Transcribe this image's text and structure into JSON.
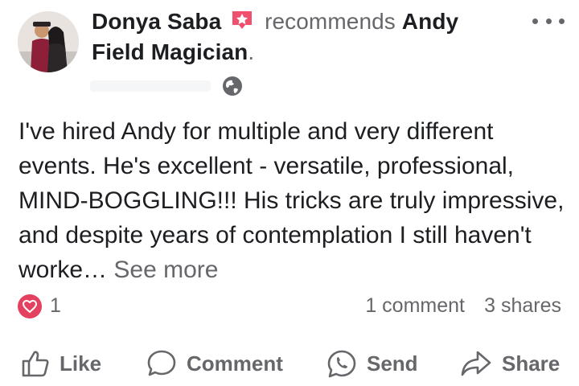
{
  "post": {
    "author": "Donya Saba",
    "verb": "recommends",
    "page_line1": "Andy",
    "page_line2": "Field Magician",
    "period": "."
  },
  "review_text": "I've hired Andy for multiple and very different events. He's excellent - versatile, professional, MIND-BOGGLING!!! His tricks are truly impressive, and despite years of contemplation I still haven't worke…",
  "see_more": "See more",
  "stats": {
    "reaction_count": "1",
    "comments": "1 comment",
    "shares": "3 shares"
  },
  "actions": {
    "like": "Like",
    "comment": "Comment",
    "send": "Send",
    "share": "Share"
  },
  "icons": {
    "more": "more-horizontal-icon",
    "privacy": "globe-icon",
    "reaction": "heart-icon",
    "badge": "recommendation-star-badge-icon"
  },
  "colors": {
    "text_primary": "#1c1e21",
    "text_secondary": "#65676b",
    "heart": "#e4405f",
    "badge": "#f0506e"
  }
}
